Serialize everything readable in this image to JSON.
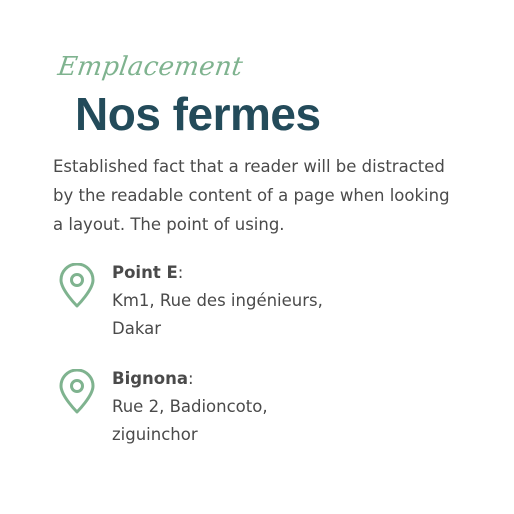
{
  "header": {
    "kicker": "Emplacement",
    "title": "Nos fermes"
  },
  "intro": "Established fact that a reader will be distracted by the readable content of a page when looking a layout. The point of using.",
  "colors": {
    "accent": "#7fb38f",
    "title": "#234b5a",
    "text": "#4a4a4a"
  },
  "locations": [
    {
      "icon": "location-pin-icon",
      "name": "Point E",
      "separator": ":",
      "line1": "Km1, Rue des ingénieurs,",
      "line2": "Dakar"
    },
    {
      "icon": "location-pin-icon",
      "name": "Bignona",
      "separator": ":",
      "line1": "Rue 2, Badioncoto,",
      "line2": "ziguinchor"
    }
  ]
}
